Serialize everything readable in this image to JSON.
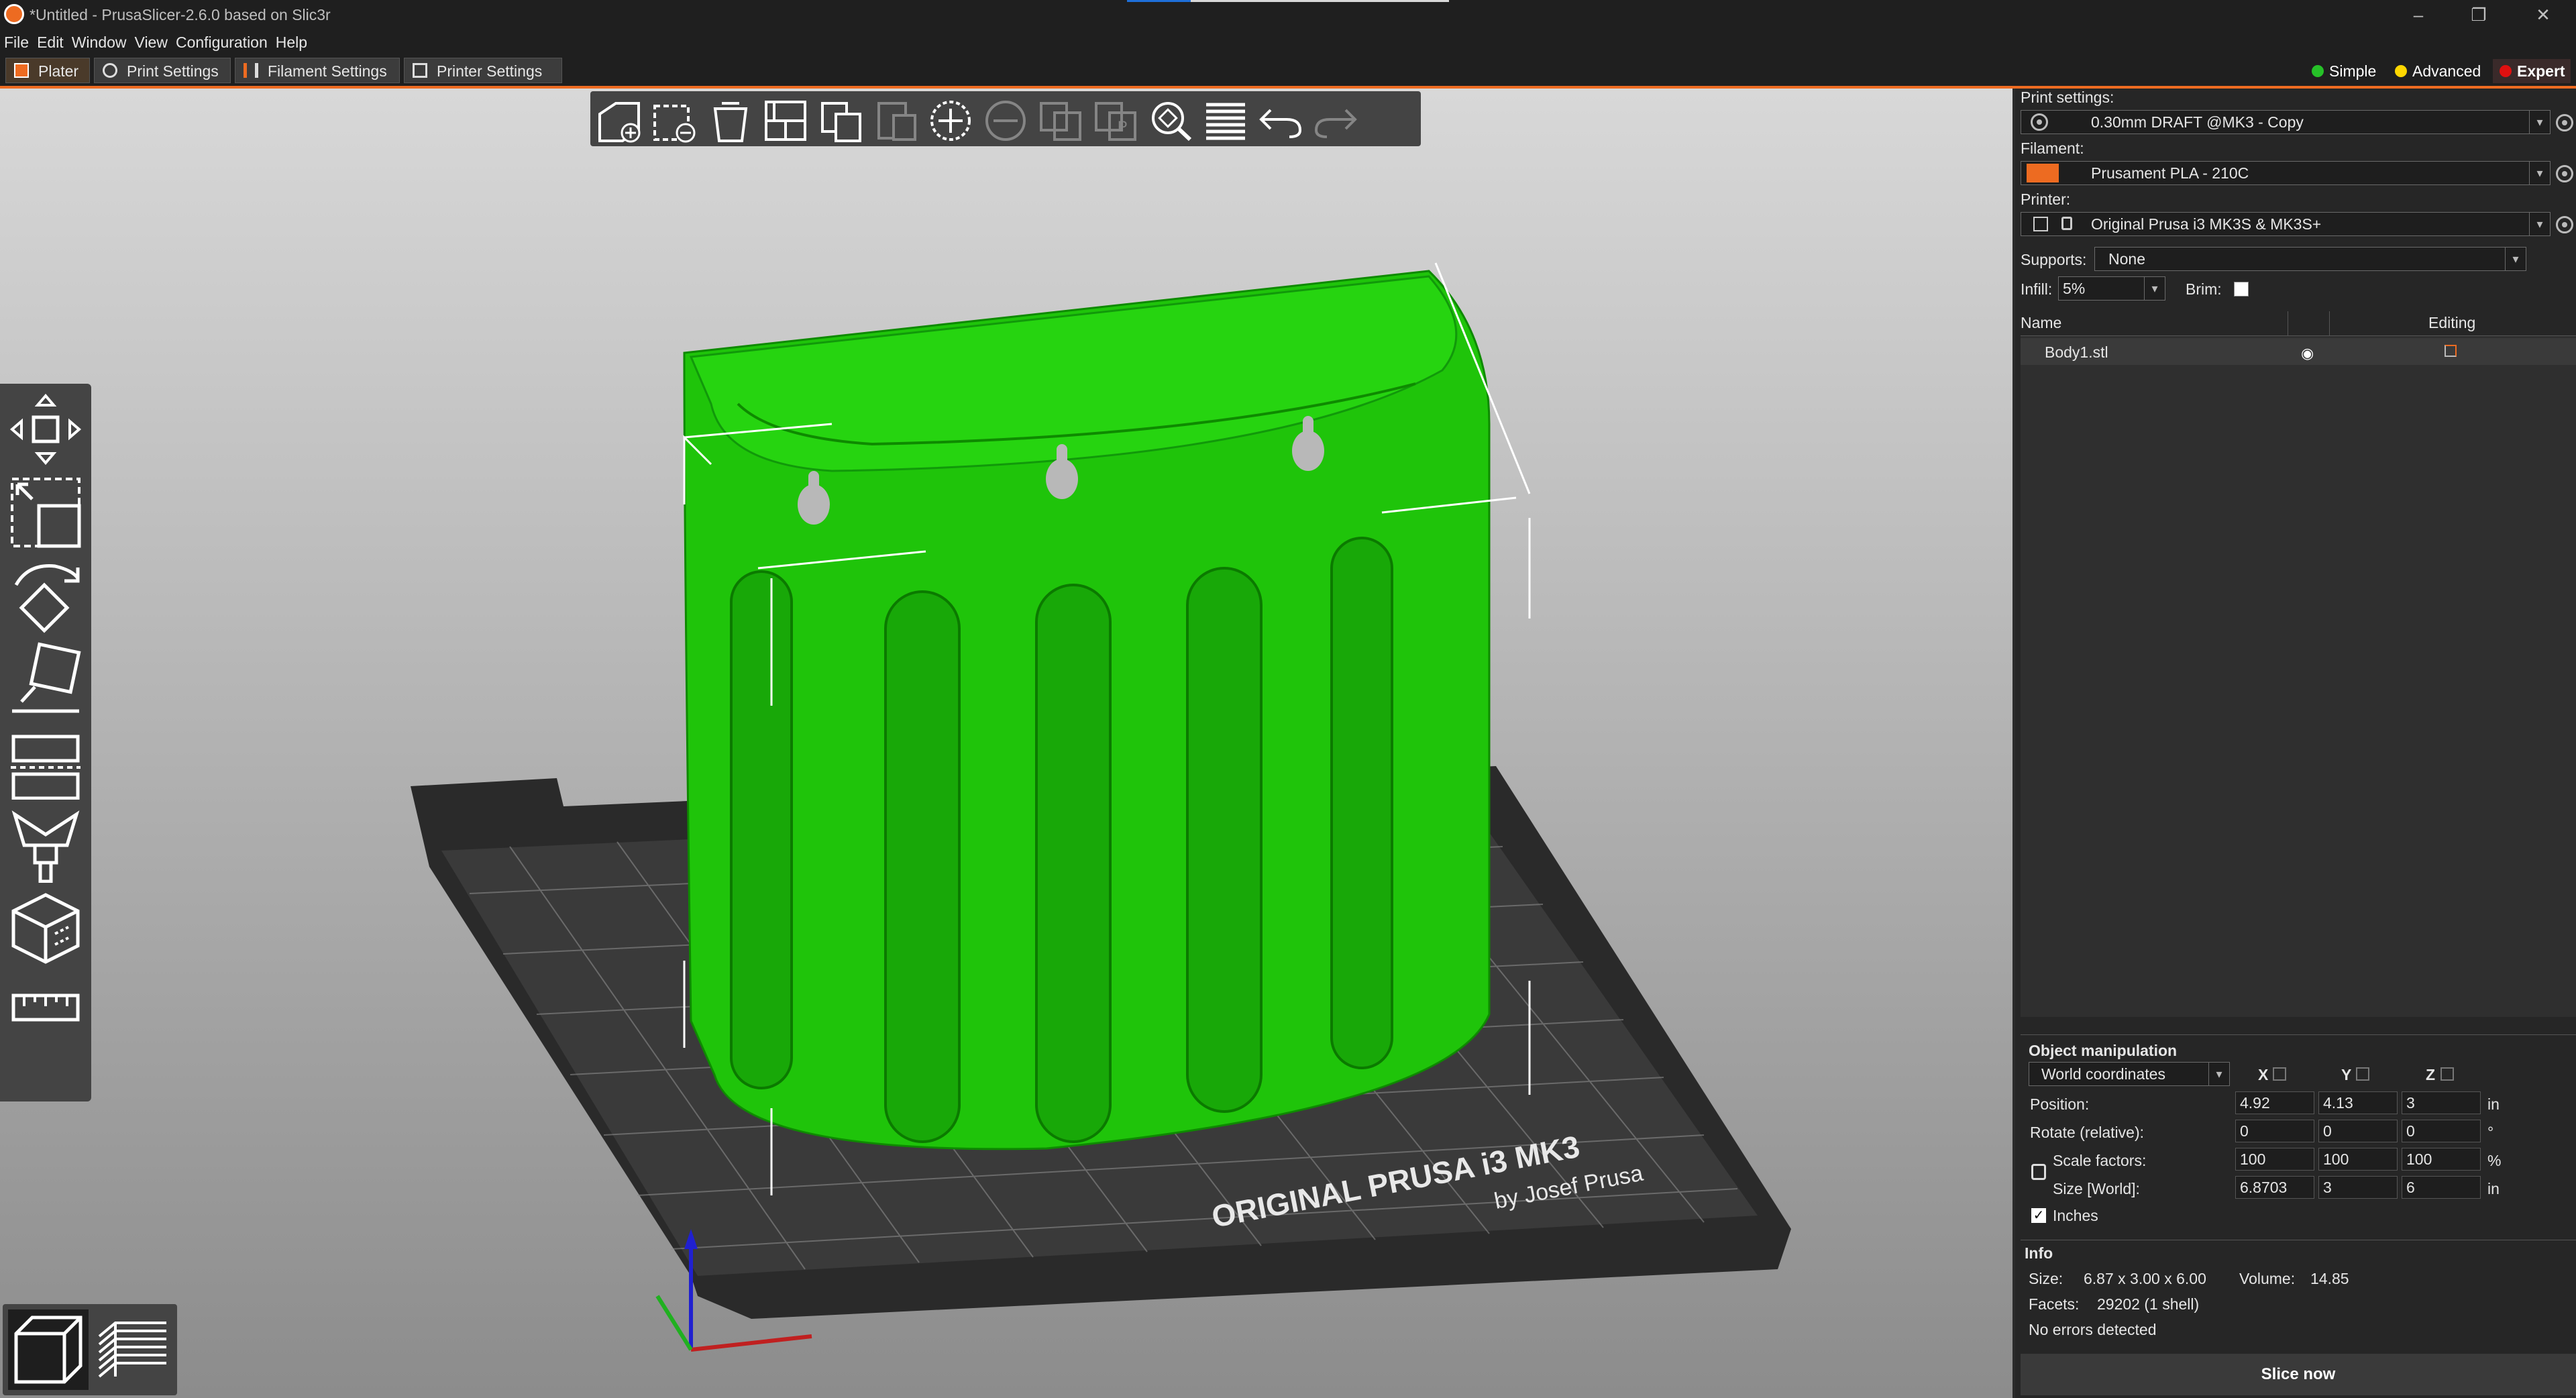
{
  "window": {
    "title": "*Untitled - PrusaSlicer-2.6.0 based on Slic3r",
    "controls": [
      "–",
      "❐",
      "✕"
    ]
  },
  "menu": [
    "File",
    "Edit",
    "Window",
    "View",
    "Configuration",
    "Help"
  ],
  "tabs": [
    {
      "label": "Plater",
      "active": true
    },
    {
      "label": "Print Settings",
      "active": false
    },
    {
      "label": "Filament Settings",
      "active": false
    },
    {
      "label": "Printer Settings",
      "active": false
    }
  ],
  "modes": [
    {
      "label": "Simple",
      "color": "#26c128"
    },
    {
      "label": "Advanced",
      "color": "#ffd700"
    },
    {
      "label": "Expert",
      "color": "#e01010"
    }
  ],
  "colors": {
    "accent": "#ed6b21",
    "model": "#1fc40a",
    "bed": "#2a2a2a",
    "filament_swatch": "#ed6b21"
  },
  "toolbar_icons": [
    "add-icon",
    "delete-icon",
    "delete-all-icon",
    "arrange-icon",
    "copy-icon",
    "paste-icon",
    "add-instance-icon",
    "remove-instance-icon",
    "split-objects-icon",
    "split-parts-icon",
    "search-icon",
    "layers-editing-icon",
    "undo-icon",
    "redo-icon"
  ],
  "gizmo_icons": [
    "move-icon",
    "scale-icon",
    "rotate-icon",
    "place-on-face-icon",
    "cut-icon",
    "cut-plane-icon",
    "paint-supports-icon",
    "seam-painting-icon",
    "measure-icon"
  ],
  "bed": {
    "brand_line1": "ORIGINAL PRUSA i3  MK3",
    "brand_line2": "by Josef Prusa"
  },
  "panel": {
    "print_settings_label": "Print settings:",
    "print_settings_value": "0.30mm DRAFT @MK3 - Copy",
    "filament_label": "Filament:",
    "filament_value": "Prusament PLA - 210C",
    "printer_label": "Printer:",
    "printer_value": "Original Prusa i3 MK3S & MK3S+",
    "supports_label": "Supports:",
    "supports_value": "None",
    "infill_label": "Infill:",
    "infill_value": "5%",
    "brim_label": "Brim:",
    "brim_checked": false
  },
  "object_list": {
    "col_name": "Name",
    "col_editing": "Editing",
    "rows": [
      {
        "name": "Body1.stl"
      }
    ]
  },
  "object_manipulation": {
    "title": "Object manipulation",
    "coord_system": "World coordinates",
    "axes": [
      "X",
      "Y",
      "Z"
    ],
    "rows": [
      {
        "label": "Position:",
        "values": [
          "4.92",
          "4.13",
          "3"
        ],
        "unit": "in"
      },
      {
        "label": "Rotate (relative):",
        "values": [
          "0",
          "0",
          "0"
        ],
        "unit": "°"
      },
      {
        "label": "Scale factors:",
        "values": [
          "100",
          "100",
          "100"
        ],
        "unit": "%"
      },
      {
        "label": "Size [World]:",
        "values": [
          "6.8703",
          "3",
          "6"
        ],
        "unit": "in"
      }
    ],
    "inches_label": "Inches",
    "inches_checked": true
  },
  "info": {
    "title": "Info",
    "size_label": "Size:",
    "size_value": "6.87 x 3.00 x 6.00",
    "volume_label": "Volume:",
    "volume_value": "14.85",
    "facets_label": "Facets:",
    "facets_value": "29202 (1 shell)",
    "errors": "No errors detected"
  },
  "slice_button": "Slice now"
}
